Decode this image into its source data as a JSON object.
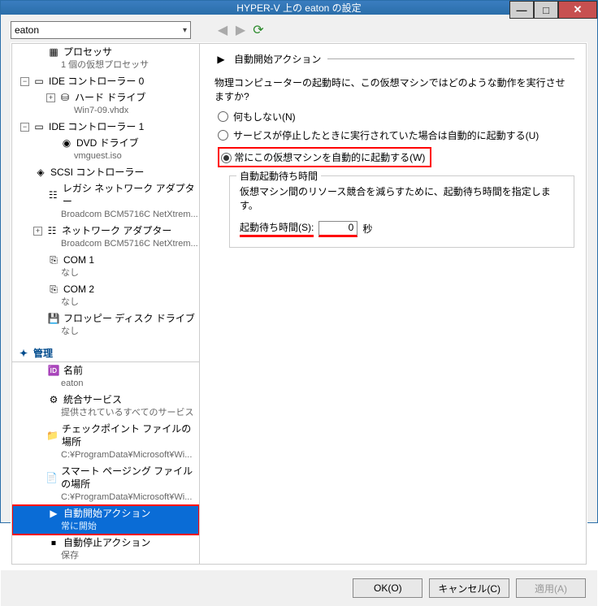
{
  "window": {
    "title": "HYPER-V 上の eaton の設定"
  },
  "vm_select": {
    "value": "eaton"
  },
  "sidebar": {
    "management_header": "管理",
    "items": [
      {
        "label": "プロセッサ",
        "sub": "1 個の仮想プロセッサ",
        "level": 1,
        "icon": "cpu"
      },
      {
        "label": "IDE コントローラー 0",
        "level": 0,
        "icon": "ide",
        "exp": "−"
      },
      {
        "label": "ハード ドライブ",
        "sub": "Win7-09.vhdx",
        "level": 2,
        "icon": "hdd",
        "exp": "+"
      },
      {
        "label": "IDE コントローラー 1",
        "level": 0,
        "icon": "ide",
        "exp": "−"
      },
      {
        "label": "DVD ドライブ",
        "sub": "vmguest.iso",
        "level": 2,
        "icon": "dvd"
      },
      {
        "label": "SCSI コントローラー",
        "level": 0,
        "icon": "scsi"
      },
      {
        "label": "レガシ ネットワーク アダプター",
        "sub": "Broadcom BCM5716C NetXtrem...",
        "level": 1,
        "icon": "nic"
      },
      {
        "label": "ネットワーク アダプター",
        "sub": "Broadcom BCM5716C NetXtrem...",
        "level": 1,
        "icon": "nic",
        "exp": "+"
      },
      {
        "label": "COM 1",
        "sub": "なし",
        "level": 1,
        "icon": "com"
      },
      {
        "label": "COM 2",
        "sub": "なし",
        "level": 1,
        "icon": "com"
      },
      {
        "label": "フロッピー ディスク ドライブ",
        "sub": "なし",
        "level": 1,
        "icon": "floppy"
      }
    ],
    "mgmt_items": [
      {
        "label": "名前",
        "sub": "eaton",
        "icon": "name"
      },
      {
        "label": "統合サービス",
        "sub": "提供されているすべてのサービス",
        "icon": "svc"
      },
      {
        "label": "チェックポイント ファイルの場所",
        "sub": "C:¥ProgramData¥Microsoft¥Wi...",
        "icon": "chk"
      },
      {
        "label": "スマート ページング ファイルの場所",
        "sub": "C:¥ProgramData¥Microsoft¥Wi...",
        "icon": "page"
      },
      {
        "label": "自動開始アクション",
        "sub": "常に開始",
        "icon": "start",
        "selected": true
      },
      {
        "label": "自動停止アクション",
        "sub": "保存",
        "icon": "stop"
      }
    ]
  },
  "content": {
    "header": "自動開始アクション",
    "question": "物理コンピューターの起動時に、この仮想マシンではどのような動作を実行させますか?",
    "radios": [
      {
        "label": "何もしない(N)",
        "checked": false
      },
      {
        "label": "サービスが停止したときに実行されていた場合は自動的に起動する(U)",
        "checked": false
      },
      {
        "label": "常にこの仮想マシンを自動的に起動する(W)",
        "checked": true,
        "red": true
      }
    ],
    "group": {
      "legend": "自動起動待ち時間",
      "desc": "仮想マシン間のリソース競合を減らすために、起動待ち時間を指定します。",
      "wait_label": "起動待ち時間(S):",
      "wait_value": "0",
      "wait_unit": "秒"
    }
  },
  "buttons": {
    "ok": "OK(O)",
    "cancel": "キャンセル(C)",
    "apply": "適用(A)"
  }
}
